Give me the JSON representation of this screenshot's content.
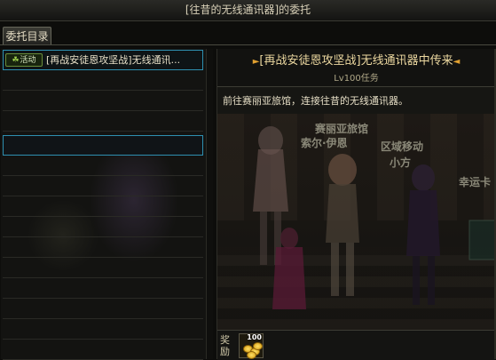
{
  "window": {
    "title": "[往昔的无线通讯器]的委托"
  },
  "tabs": [
    {
      "label": "委托目录"
    }
  ],
  "quest_list": {
    "items": [
      {
        "badge": "活动",
        "name": "[再战安徒恩攻坚战]无线通讯..."
      }
    ]
  },
  "detail": {
    "title": "[再战安徒恩攻坚战]无线通讯器中传来",
    "level": "Lv100任务",
    "description": "前往赛丽亚旅馆，连接往昔的无线通讯器。",
    "scene_labels": [
      "赛丽亚旅馆",
      "索尔·伊恩",
      "区域移动",
      "小方",
      "幸运卡"
    ],
    "reward": {
      "label": "奖励",
      "item_count": "100",
      "item_icon": "gold-coins-icon"
    }
  },
  "colors": {
    "accent": "#2e8fb0",
    "title_text": "#ecd8a0",
    "badge_green": "#9ed04c"
  }
}
